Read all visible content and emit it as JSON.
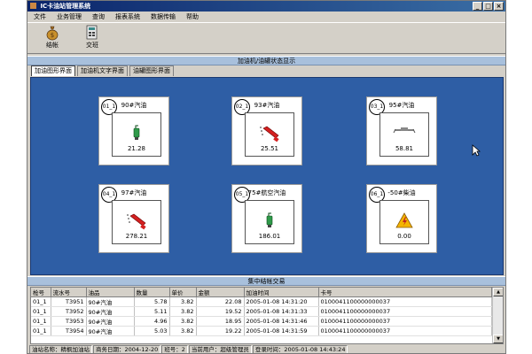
{
  "window": {
    "title": "IC卡油站管理系统",
    "buttons": [
      "_",
      "□",
      "×"
    ]
  },
  "menu": [
    "文件",
    "业务管理",
    "查询",
    "报表系统",
    "数据传输",
    "帮助"
  ],
  "toolbar": [
    {
      "label": "结帐",
      "icon": "money-bag-icon"
    },
    {
      "label": "交班",
      "icon": "handover-icon"
    }
  ],
  "status_panel_title": "加油机/油罐状态显示",
  "tabs": [
    {
      "label": "加油图形界面",
      "active": true
    },
    {
      "label": "加油机文字界面",
      "active": false
    },
    {
      "label": "油罐图形界面",
      "active": false
    }
  ],
  "pumps": [
    {
      "id": "01_1",
      "fuel": "90#汽油",
      "amount": "21.28",
      "state": "nozzle-green"
    },
    {
      "id": "02_1",
      "fuel": "93#汽油",
      "amount": "25.51",
      "state": "nozzle-red-pump"
    },
    {
      "id": "03_1",
      "fuel": "95#汽油",
      "amount": "58.81",
      "state": "nozzle-off"
    },
    {
      "id": "04_1",
      "fuel": "97#汽油",
      "amount": "278.21",
      "state": "nozzle-red-pump"
    },
    {
      "id": "05_1",
      "fuel": "75#航空汽油",
      "amount": "186.01",
      "state": "nozzle-green"
    },
    {
      "id": "06_1",
      "fuel": "-50#柴油",
      "amount": "0.00",
      "state": "warning"
    }
  ],
  "transactions_title": "集中结帐交易",
  "table": {
    "columns": [
      "枪号",
      "流水号",
      "油品",
      "数量",
      "单价",
      "金额",
      "加油时间",
      "卡号"
    ],
    "rows": [
      [
        "01_1",
        "T3951",
        "90#汽油",
        "5.78",
        "3.82",
        "22.08",
        "2005-01-08  14:31:20",
        "0100041100000000037"
      ],
      [
        "01_1",
        "T3952",
        "90#汽油",
        "5.11",
        "3.82",
        "19.52",
        "2005-01-08  14:31:33",
        "0100041100000000037"
      ],
      [
        "01_1",
        "T3953",
        "90#汽油",
        "4.96",
        "3.82",
        "18.95",
        "2005-01-08  14:31:46",
        "0100041100000000037"
      ],
      [
        "01_1",
        "T3954",
        "90#汽油",
        "5.03",
        "3.82",
        "19.22",
        "2005-01-08  14:31:59",
        "0100041100000000037"
      ]
    ]
  },
  "statusbar": {
    "station_label": "油站名称：",
    "station_value": "精枫加油站",
    "date_label": "商务日期：",
    "date_value": "2004-12-20",
    "shift_label": "班号：",
    "shift_value": "2",
    "user_label": "当前用户：",
    "user_value": "超级管理员",
    "login_label": "登录时间：",
    "login_value": "2005-01-08 14:43:24"
  }
}
